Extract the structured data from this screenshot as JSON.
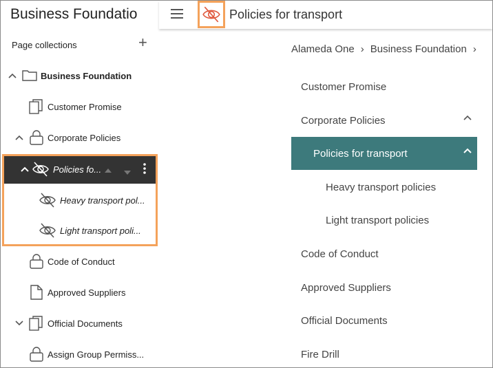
{
  "app": {
    "title": "Business Foundatio"
  },
  "page_collections": {
    "label": "Page collections"
  },
  "tree": {
    "root": {
      "label": "Business Foundation"
    },
    "items": [
      {
        "label": "Customer Promise"
      },
      {
        "label": "Corporate Policies"
      },
      {
        "label": "Policies fo..."
      },
      {
        "label": "Heavy transport pol..."
      },
      {
        "label": "Light transport poli..."
      },
      {
        "label": "Code of Conduct"
      },
      {
        "label": "Approved Suppliers"
      },
      {
        "label": "Official Documents"
      },
      {
        "label": "Assign Group Permiss..."
      }
    ]
  },
  "header": {
    "page_title": "Policies for transport"
  },
  "breadcrumb": {
    "items": [
      "Alameda One",
      "Business Foundation"
    ],
    "separator": "›"
  },
  "nav": {
    "items": [
      {
        "label": "Customer Promise"
      },
      {
        "label": "Corporate Policies"
      },
      {
        "label": "Policies for transport"
      },
      {
        "label": "Heavy transport policies"
      },
      {
        "label": "Light transport policies"
      },
      {
        "label": "Code of Conduct"
      },
      {
        "label": "Approved Suppliers"
      },
      {
        "label": "Official Documents"
      },
      {
        "label": "Fire Drill"
      }
    ]
  },
  "colors": {
    "accent": "#3d7a7c",
    "highlight": "#f4a25b",
    "selected_row": "#333333",
    "hidden_icon": "#e05a40"
  }
}
